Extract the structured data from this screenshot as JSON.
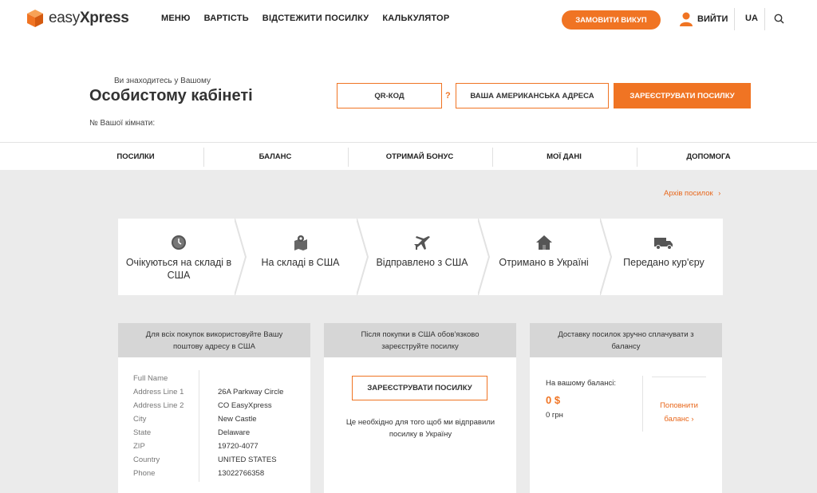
{
  "header": {
    "logo_light": "easy",
    "logo_bold": "Xpress",
    "nav": [
      "МЕНЮ",
      "ВАРТІСТЬ",
      "ВІДСТЕЖИТИ ПОСИЛКУ",
      "КАЛЬКУЛЯТОР"
    ],
    "buyout_button": "ЗАМОВИТИ ВИКУП",
    "logout": "ВИЙТИ",
    "lang": "UA",
    "accent_color": "#f07423"
  },
  "cabinet": {
    "subtitle": "Ви знаходитесь у Вашому",
    "title": "Особистому кабінеті",
    "room_label": "№ Вашої кімнати:",
    "qr_button": "QR-КОД",
    "help_mark": "?",
    "us_address_button": "ВАША АМЕРИКАНСЬКА АДРЕСА",
    "register_button": "ЗАРЕЄСТРУВАТИ ПОСИЛКУ"
  },
  "tabs": [
    "ПОСИЛКИ",
    "БАЛАНС",
    "ОТРИМАЙ БОНУС",
    "МОЇ ДАНІ",
    "ДОПОМОГА"
  ],
  "archive_link": "Архів посилок",
  "steps": [
    {
      "label": "Очікуються на складі в США",
      "icon": "clock-icon"
    },
    {
      "label": "На складі в США",
      "icon": "map-pin-icon"
    },
    {
      "label": "Відправлено з США",
      "icon": "airplane-icon"
    },
    {
      "label": "Отримано в Україні",
      "icon": "house-icon"
    },
    {
      "label": "Передано кур'єру",
      "icon": "truck-icon"
    }
  ],
  "address_card": {
    "header": "Для всіх покупок використовуйте Вашу поштову адресу в США",
    "rows": [
      {
        "key": "Full Name",
        "value": ""
      },
      {
        "key": "Address Line 1",
        "value": "26A Parkway Circle"
      },
      {
        "key": "Address Line 2",
        "value": "CO EasyXpress"
      },
      {
        "key": "City",
        "value": "New Castle"
      },
      {
        "key": "State",
        "value": "Delaware"
      },
      {
        "key": "ZIP",
        "value": "19720-4077"
      },
      {
        "key": "Country",
        "value": "UNITED STATES"
      },
      {
        "key": "Phone",
        "value": "13022766358"
      }
    ]
  },
  "register_card": {
    "header": "Після покупки в США обов'язково зареєструйте посилку",
    "button": "ЗАРЕЄСТРУВАТИ ПОСИЛКУ",
    "note": "Це необхідно для того щоб ми відправили посилку в Україну"
  },
  "balance_card": {
    "header": "Доставку посилок зручно сплачувати з балансу",
    "label": "На вашому балансі:",
    "usd": "0 $",
    "uah": "0 грн",
    "topup": "Поповнити баланс"
  }
}
